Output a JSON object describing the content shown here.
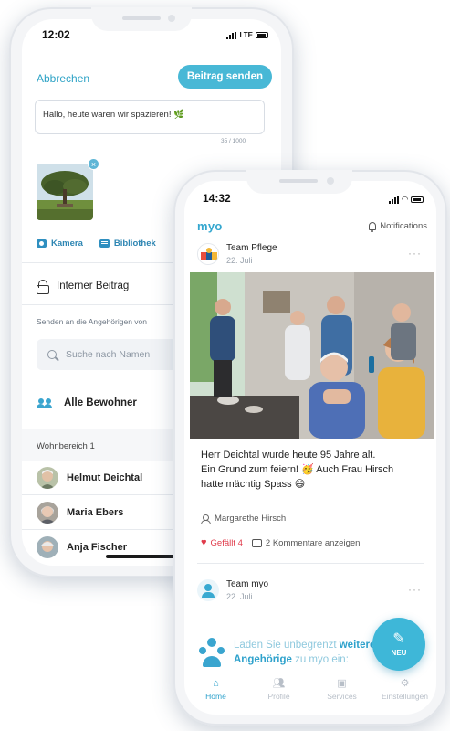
{
  "compose_screen": {
    "status_time": "12:02",
    "carrier": "LTE",
    "cancel_label": "Abbrechen",
    "send_label": "Beitrag senden",
    "message_value": "Hallo, heute waren wir spazieren! 🌿",
    "char_count": "35 / 1000",
    "camera_label": "Kamera",
    "library_label": "Bibliothek",
    "internal_post_label": "Interner Beitrag",
    "send_to_label": "Senden an die Angehörigen von",
    "search_placeholder": "Suche nach Namen",
    "all_residents_label": "Alle Bewohner",
    "section_label": "Wohnbereich 1",
    "residents": [
      "Helmut Deichtal",
      "Maria Ebers",
      "Anja Fischer"
    ]
  },
  "feed_screen": {
    "status_time": "14:32",
    "app_logo": "myo",
    "notifications_label": "Notifications",
    "post1": {
      "author": "Team Pflege",
      "date": "22. Juli",
      "text_lines": [
        "Herr Deichtal wurde heute 95 Jahre alt.",
        "Ein Grund zum feiern! 🥳 Auch Frau Hirsch",
        "hatte mächtig Spass 😄"
      ],
      "tagged_person": "Margarethe Hirsch",
      "likes_label": "Gefällt 4",
      "comments_label": "2 Kommentare anzeigen"
    },
    "post2": {
      "author": "Team myo",
      "date": "22. Juli"
    },
    "invite": {
      "text_before": "Laden Sie unbegrenzt ",
      "bold1": "weitere",
      "bold2": "Angehörige",
      "text_after": " zu myo ein:"
    },
    "fab_label": "NEU",
    "tabs": [
      {
        "label": "Home",
        "icon": "home-icon"
      },
      {
        "label": "Profile",
        "icon": "people-icon"
      },
      {
        "label": "Services",
        "icon": "services-icon"
      },
      {
        "label": "Einstellungen",
        "icon": "gear-icon"
      }
    ],
    "accent_color": "#35a7cf"
  }
}
